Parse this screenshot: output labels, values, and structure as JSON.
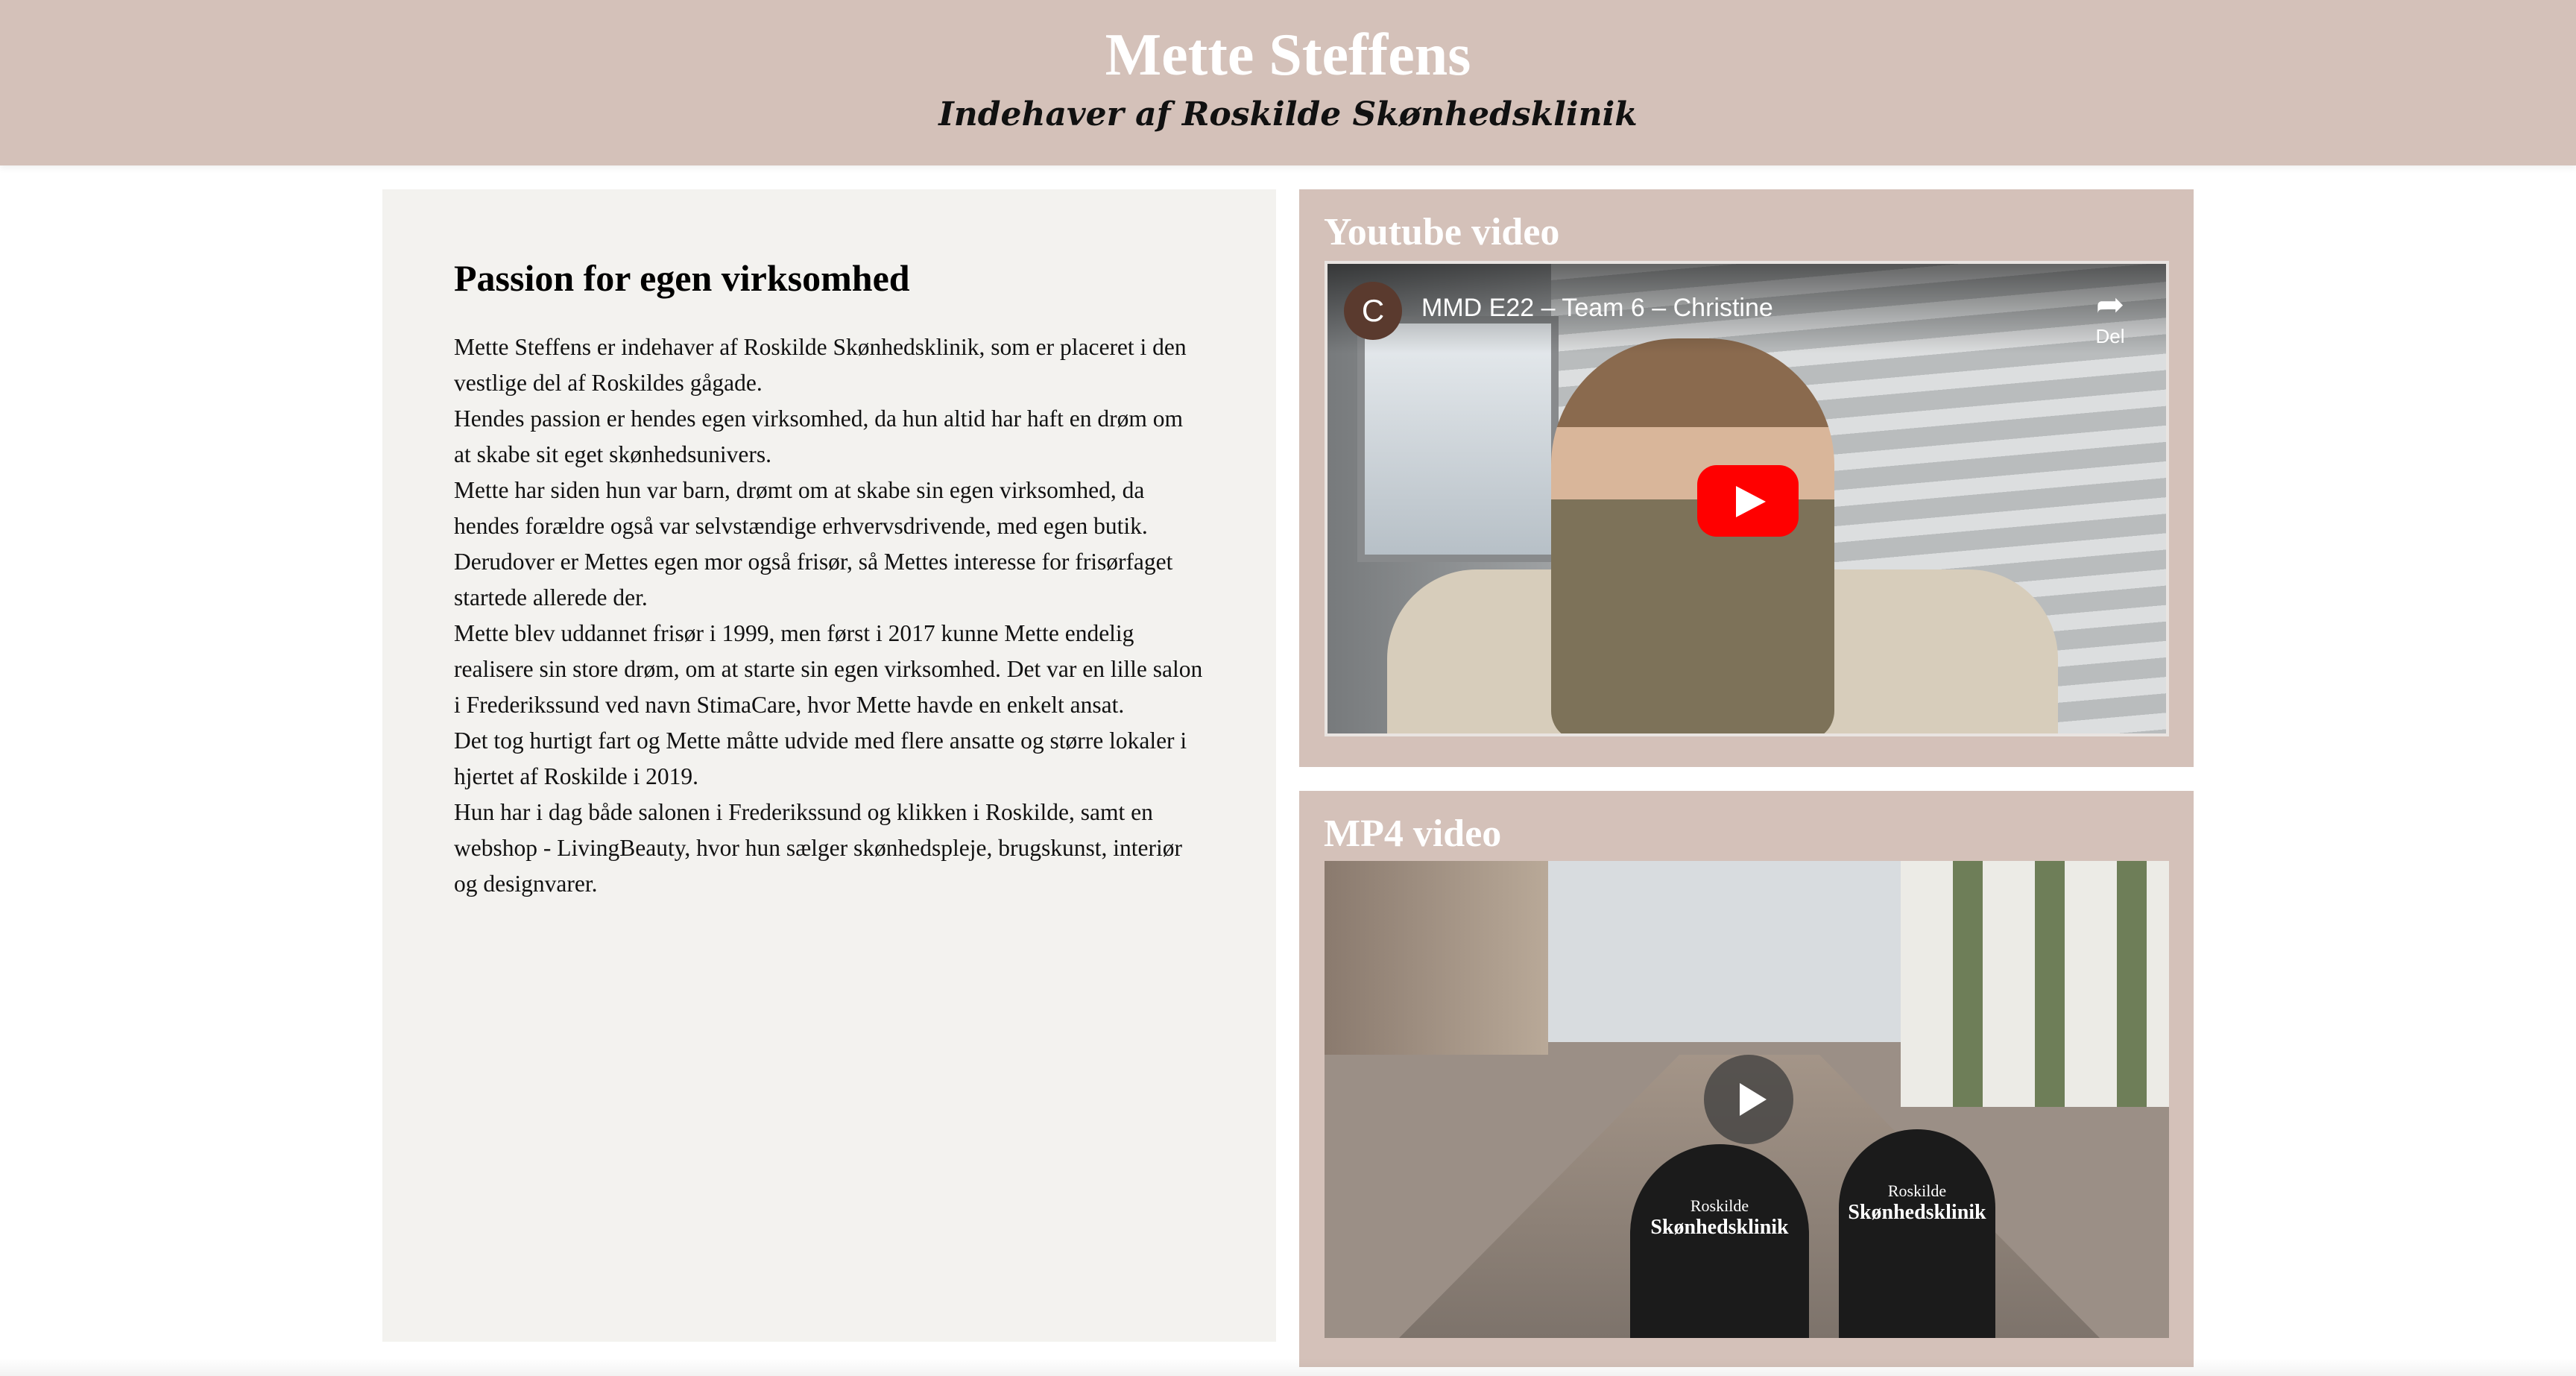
{
  "header": {
    "title": "Mette Steffens",
    "subtitle": "Indehaver af Roskilde Skønhedsklinik"
  },
  "about": {
    "heading": "Passion for egen virksomhed",
    "paragraphs": [
      "Mette Steffens er indehaver af Roskilde Skønhedsklinik, som er placeret i den vestlige del af Roskildes gågade.",
      "Hendes passion er hendes egen virksomhed, da hun altid har haft en drøm om at skabe sit eget skønhedsunivers.",
      "Mette har siden hun var barn, drømt om at skabe sin egen virksomhed, da hendes forældre også var selvstændige erhvervsdrivende, med egen butik.",
      "Derudover er Mettes egen mor også frisør, så Mettes interesse for frisørfaget startede allerede der.",
      "Mette blev uddannet frisør i 1999, men først i 2017 kunne Mette endelig realisere sin store drøm, om at starte sin egen virksomhed. Det var en lille salon i Frederikssund ved navn StimaCare, hvor Mette havde en enkelt ansat.",
      "Det tog hurtigt fart og Mette måtte udvide med flere ansatte og større lokaler i hjertet af Roskilde i 2019.",
      "Hun har i dag både salonen i Frederikssund og klikken i Roskilde, samt en webshop - LivingBeauty, hvor hun sælger skønhedspleje, brugskunst, interiør og designvarer."
    ]
  },
  "youtube": {
    "section_title": "Youtube video",
    "channel_initial": "C",
    "video_title": "MMD E22 – Team 6 – Christine",
    "share_label": "Del",
    "icons": {
      "share": "share-arrow-icon",
      "play": "youtube-play-icon"
    }
  },
  "mp4": {
    "section_title": "MP4 video",
    "sign_line1": "Roskilde",
    "sign_line2": "Skønhedsklinik",
    "icons": {
      "play": "play-icon"
    }
  },
  "colors": {
    "header_bg": "#d4c1b9",
    "panel_bg": "#f3f2ef",
    "youtube_red": "#ff0000"
  }
}
